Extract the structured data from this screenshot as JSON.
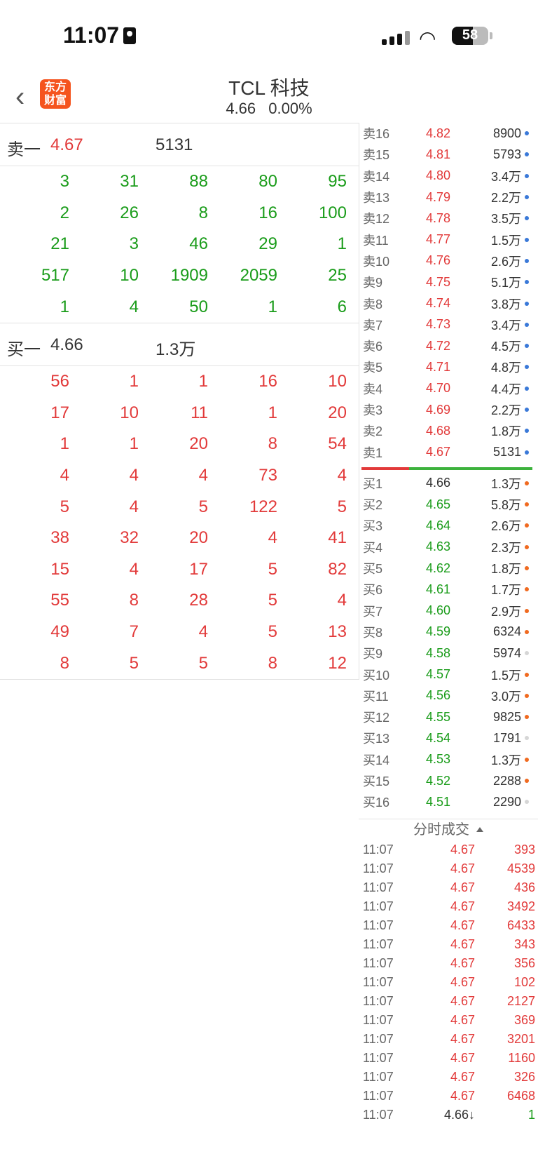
{
  "status_bar": {
    "time": "11:07",
    "battery": "58",
    "battery_level": 0.58
  },
  "header": {
    "back_icon": "chevron-left-icon",
    "logo_text": "东方财富",
    "title": "TCL 科技",
    "price": "4.66",
    "change": "0.00%"
  },
  "colors": {
    "red": "#e23a3a",
    "green": "#1a9c1a",
    "blue_dot": "#3a79d8",
    "orange_dot": "#f06a20",
    "grey_dot": "#d6d6d6",
    "logo": "#f5541e"
  },
  "sell_one": {
    "label": "卖一",
    "price": "4.67",
    "volume": "5131",
    "queue": [
      [
        "3",
        "31",
        "88",
        "80",
        "95"
      ],
      [
        "2",
        "26",
        "8",
        "16",
        "100"
      ],
      [
        "21",
        "3",
        "46",
        "29",
        "1"
      ],
      [
        "517",
        "10",
        "1909",
        "2059",
        "25"
      ],
      [
        "1",
        "4",
        "50",
        "1",
        "6"
      ]
    ]
  },
  "buy_one": {
    "label": "买一",
    "price": "4.66",
    "volume": "1.3万",
    "queue": [
      [
        "56",
        "1",
        "1",
        "16",
        "10"
      ],
      [
        "17",
        "10",
        "11",
        "1",
        "20"
      ],
      [
        "1",
        "1",
        "20",
        "8",
        "54"
      ],
      [
        "4",
        "4",
        "4",
        "73",
        "4"
      ],
      [
        "5",
        "4",
        "5",
        "122",
        "5"
      ],
      [
        "38",
        "32",
        "20",
        "4",
        "41"
      ],
      [
        "15",
        "4",
        "17",
        "5",
        "82"
      ],
      [
        "55",
        "8",
        "28",
        "5",
        "4"
      ],
      [
        "49",
        "7",
        "4",
        "5",
        "13"
      ],
      [
        "8",
        "5",
        "5",
        "8",
        "12"
      ]
    ]
  },
  "asks": [
    {
      "label": "卖16",
      "price": "4.82",
      "volume": "8900",
      "dot": "blue"
    },
    {
      "label": "卖15",
      "price": "4.81",
      "volume": "5793",
      "dot": "blue"
    },
    {
      "label": "卖14",
      "price": "4.80",
      "volume": "3.4万",
      "dot": "blue"
    },
    {
      "label": "卖13",
      "price": "4.79",
      "volume": "2.2万",
      "dot": "blue"
    },
    {
      "label": "卖12",
      "price": "4.78",
      "volume": "3.5万",
      "dot": "blue"
    },
    {
      "label": "卖11",
      "price": "4.77",
      "volume": "1.5万",
      "dot": "blue"
    },
    {
      "label": "卖10",
      "price": "4.76",
      "volume": "2.6万",
      "dot": "blue"
    },
    {
      "label": "卖9",
      "price": "4.75",
      "volume": "5.1万",
      "dot": "blue"
    },
    {
      "label": "卖8",
      "price": "4.74",
      "volume": "3.8万",
      "dot": "blue"
    },
    {
      "label": "卖7",
      "price": "4.73",
      "volume": "3.4万",
      "dot": "blue"
    },
    {
      "label": "卖6",
      "price": "4.72",
      "volume": "4.5万",
      "dot": "blue"
    },
    {
      "label": "卖5",
      "price": "4.71",
      "volume": "4.8万",
      "dot": "blue"
    },
    {
      "label": "卖4",
      "price": "4.70",
      "volume": "4.4万",
      "dot": "blue"
    },
    {
      "label": "卖3",
      "price": "4.69",
      "volume": "2.2万",
      "dot": "blue"
    },
    {
      "label": "卖2",
      "price": "4.68",
      "volume": "1.8万",
      "dot": "blue"
    },
    {
      "label": "卖1",
      "price": "4.67",
      "volume": "5131",
      "dot": "blue"
    }
  ],
  "bids": [
    {
      "label": "买1",
      "price": "4.66",
      "volume": "1.3万",
      "dot": "orange",
      "color": "dark"
    },
    {
      "label": "买2",
      "price": "4.65",
      "volume": "5.8万",
      "dot": "orange",
      "color": "green"
    },
    {
      "label": "买3",
      "price": "4.64",
      "volume": "2.6万",
      "dot": "orange",
      "color": "green"
    },
    {
      "label": "买4",
      "price": "4.63",
      "volume": "2.3万",
      "dot": "orange",
      "color": "green"
    },
    {
      "label": "买5",
      "price": "4.62",
      "volume": "1.8万",
      "dot": "orange",
      "color": "green"
    },
    {
      "label": "买6",
      "price": "4.61",
      "volume": "1.7万",
      "dot": "orange",
      "color": "green"
    },
    {
      "label": "买7",
      "price": "4.60",
      "volume": "2.9万",
      "dot": "orange",
      "color": "green"
    },
    {
      "label": "买8",
      "price": "4.59",
      "volume": "6324",
      "dot": "orange",
      "color": "green"
    },
    {
      "label": "买9",
      "price": "4.58",
      "volume": "5974",
      "dot": "grey",
      "color": "green"
    },
    {
      "label": "买10",
      "price": "4.57",
      "volume": "1.5万",
      "dot": "orange",
      "color": "green"
    },
    {
      "label": "买11",
      "price": "4.56",
      "volume": "3.0万",
      "dot": "orange",
      "color": "green"
    },
    {
      "label": "买12",
      "price": "4.55",
      "volume": "9825",
      "dot": "orange",
      "color": "green"
    },
    {
      "label": "买13",
      "price": "4.54",
      "volume": "1791",
      "dot": "grey",
      "color": "green"
    },
    {
      "label": "买14",
      "price": "4.53",
      "volume": "1.3万",
      "dot": "orange",
      "color": "green"
    },
    {
      "label": "买15",
      "price": "4.52",
      "volume": "2288",
      "dot": "orange",
      "color": "green"
    },
    {
      "label": "买16",
      "price": "4.51",
      "volume": "2290",
      "dot": "grey",
      "color": "green"
    }
  ],
  "ticks": {
    "title": "分时成交",
    "rows": [
      {
        "time": "11:07",
        "price": "4.67",
        "volume": "393",
        "color": "red"
      },
      {
        "time": "11:07",
        "price": "4.67",
        "volume": "4539",
        "color": "red"
      },
      {
        "time": "11:07",
        "price": "4.67",
        "volume": "436",
        "color": "red"
      },
      {
        "time": "11:07",
        "price": "4.67",
        "volume": "3492",
        "color": "red"
      },
      {
        "time": "11:07",
        "price": "4.67",
        "volume": "6433",
        "color": "red"
      },
      {
        "time": "11:07",
        "price": "4.67",
        "volume": "343",
        "color": "red"
      },
      {
        "time": "11:07",
        "price": "4.67",
        "volume": "356",
        "color": "red"
      },
      {
        "time": "11:07",
        "price": "4.67",
        "volume": "102",
        "color": "red"
      },
      {
        "time": "11:07",
        "price": "4.67",
        "volume": "2127",
        "color": "red"
      },
      {
        "time": "11:07",
        "price": "4.67",
        "volume": "369",
        "color": "red"
      },
      {
        "time": "11:07",
        "price": "4.67",
        "volume": "3201",
        "color": "red"
      },
      {
        "time": "11:07",
        "price": "4.67",
        "volume": "1160",
        "color": "red"
      },
      {
        "time": "11:07",
        "price": "4.67",
        "volume": "326",
        "color": "red"
      },
      {
        "time": "11:07",
        "price": "4.67",
        "volume": "6468",
        "color": "red"
      },
      {
        "time": "11:07",
        "price": "4.66↓",
        "volume": "1",
        "color": "green"
      }
    ]
  }
}
